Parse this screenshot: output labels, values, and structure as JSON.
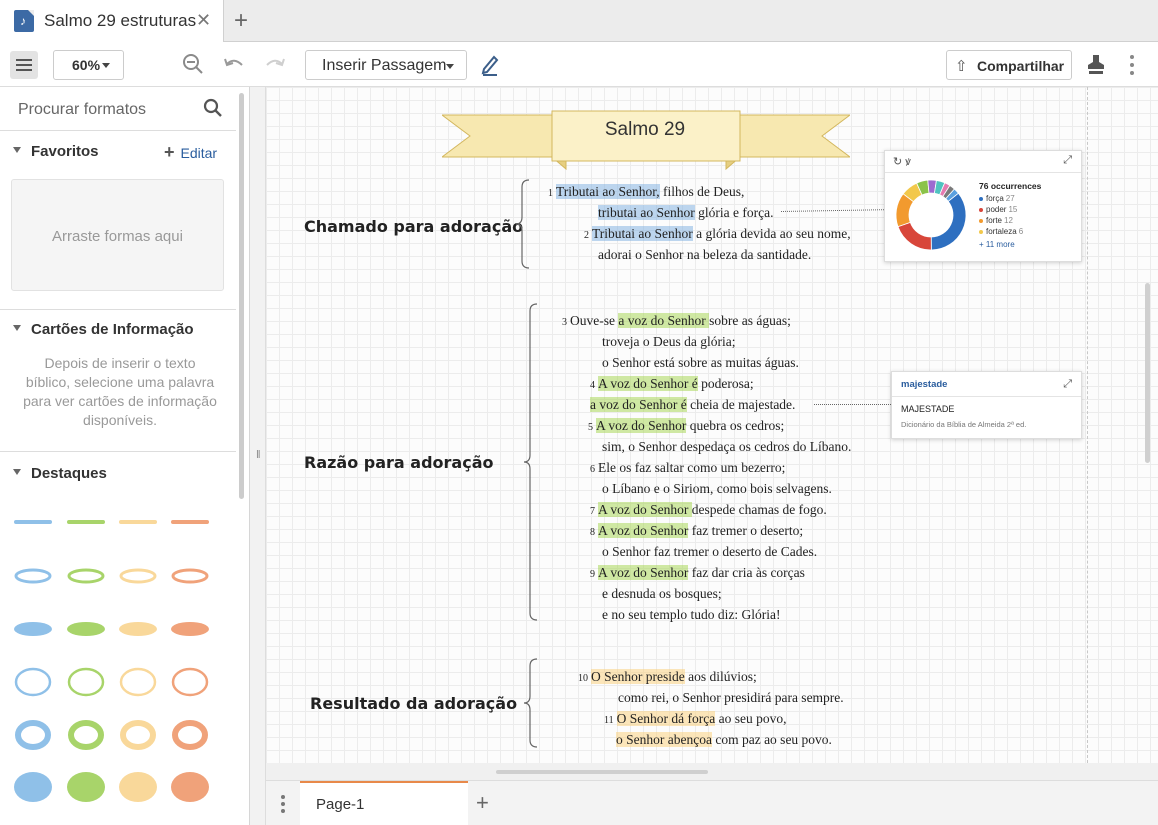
{
  "tab": {
    "title": "Salmo 29 estruturas",
    "close_icon": "close-icon",
    "add_icon": "plus-icon"
  },
  "toolbar": {
    "zoom": "60%",
    "insert_label": "Inserir Passagem",
    "share_label": "Compartilhar",
    "icons": [
      "menu-icon",
      "zoom-in-icon",
      "zoom-out-icon",
      "undo-icon",
      "redo-icon",
      "pen-icon",
      "share-icon",
      "stamp-icon",
      "more-vertical-icon"
    ]
  },
  "sidebar": {
    "search_placeholder": "Procurar formatos",
    "favorites": {
      "title": "Favoritos",
      "edit_label": "Editar",
      "dropzone_text": "Arraste formas aqui"
    },
    "info_cards": {
      "title": "Cartões de Informação",
      "text": "Depois de inserir o texto bíblico, selecione uma palavra para ver cartões de informação disponíveis."
    },
    "highlights": {
      "title": "Destaques",
      "colors": [
        "#8fc0e8",
        "#a8d46a",
        "#f9d89a",
        "#f0a27a"
      ],
      "styles": [
        "line",
        "loop",
        "flat",
        "ring",
        "thick-ring",
        "blob"
      ]
    }
  },
  "document": {
    "banner_title": "Salmo 29",
    "sections": [
      {
        "label": "Chamado para adoração",
        "lines": [
          {
            "num": "1",
            "pre": "",
            "hl": "Tributai ao Senhor,",
            "post": " filhos de Deus,",
            "color": "blue"
          },
          {
            "num": "",
            "pre": "",
            "hl": "tributai ao Senhor",
            "post": " glória e força.",
            "color": "blue"
          },
          {
            "num": "2",
            "pre": "",
            "hl": "Tributai ao Senhor",
            "post": " a glória devida ao seu nome,",
            "color": "blue"
          },
          {
            "num": "",
            "pre": "adorai o Senhor na beleza da santidade.",
            "hl": "",
            "post": "",
            "color": ""
          }
        ]
      },
      {
        "label": "Razão para adoração",
        "lines": [
          {
            "num": "3",
            "pre": "Ouve-se ",
            "hl": "a voz do Senhor ",
            "post": "sobre as águas;",
            "color": "green"
          },
          {
            "num": "",
            "pre": "troveja o Deus da glória;",
            "hl": "",
            "post": "",
            "color": ""
          },
          {
            "num": "",
            "pre": "o Senhor está sobre as muitas águas.",
            "hl": "",
            "post": "",
            "color": ""
          },
          {
            "num": "4",
            "pre": "",
            "hl": "A voz do Senhor é",
            "post": " poderosa;",
            "color": "green"
          },
          {
            "num": "",
            "pre": "",
            "hl": "a voz do Senhor é",
            "post": " cheia de majestade.",
            "color": "green"
          },
          {
            "num": "5",
            "pre": "",
            "hl": "A voz do Senhor",
            "post": " quebra os cedros;",
            "color": "green"
          },
          {
            "num": "",
            "pre": "sim, o Senhor despedaça os cedros do Líbano.",
            "hl": "",
            "post": "",
            "color": ""
          },
          {
            "num": "6",
            "pre": "Ele os faz saltar como um bezerro;",
            "hl": "",
            "post": "",
            "color": ""
          },
          {
            "num": "",
            "pre": "o Líbano e o Siriom,  como bois selvagens.",
            "hl": "",
            "post": "",
            "color": ""
          },
          {
            "num": "7",
            "pre": "",
            "hl": "A voz do Senhor ",
            "post": "despede chamas de fogo.",
            "color": "green"
          },
          {
            "num": "8",
            "pre": "",
            "hl": "A voz do Senhor",
            "post": " faz tremer o deserto;",
            "color": "green"
          },
          {
            "num": "",
            "pre": "o Senhor faz tremer o deserto de Cades.",
            "hl": "",
            "post": "",
            "color": ""
          },
          {
            "num": "9",
            "pre": "",
            "hl": "A voz do Senhor",
            "post": " faz dar cria às corças",
            "color": "green"
          },
          {
            "num": "",
            "pre": "e desnuda os bosques;",
            "hl": "",
            "post": "",
            "color": ""
          },
          {
            "num": "",
            "pre": "e no seu templo tudo diz: Glória!",
            "hl": "",
            "post": "",
            "color": ""
          }
        ]
      },
      {
        "label": "Resultado da adoração",
        "lines": [
          {
            "num": "10",
            "pre": "",
            "hl": "O Senhor preside",
            "post": " aos dilúvios;",
            "color": "yellow"
          },
          {
            "num": "",
            "pre": "como rei, o Senhor presidirá para sempre.",
            "hl": "",
            "post": "",
            "color": ""
          },
          {
            "num": "11",
            "pre": "",
            "hl": "O Senhor dá força",
            "post": " ao seu povo,",
            "color": "yellow"
          },
          {
            "num": "",
            "pre": "",
            "hl": "o Senhor abençoa",
            "post": " com paz ao seu povo.",
            "color": "yellow"
          }
        ]
      }
    ]
  },
  "word_card": {
    "icons": [
      "refresh-icon",
      "lexicon-icon",
      "open-card-icon"
    ],
    "occurrences_title": "76 occurrences",
    "items": [
      {
        "label": "força",
        "count": "27",
        "color": "#2e6fc0"
      },
      {
        "label": "poder",
        "count": "15",
        "color": "#d8463a"
      },
      {
        "label": "forte",
        "count": "12",
        "color": "#f29a2e"
      },
      {
        "label": "fortaleza",
        "count": "6",
        "color": "#f2c84b"
      }
    ],
    "more_label": "+ 11 more",
    "donut": [
      {
        "value": 27,
        "color": "#2e6fc0"
      },
      {
        "value": 15,
        "color": "#d8463a"
      },
      {
        "value": 12,
        "color": "#f29a2e"
      },
      {
        "value": 6,
        "color": "#f2c84b"
      },
      {
        "value": 4,
        "color": "#8bc34a"
      },
      {
        "value": 3,
        "color": "#9c6ad0"
      },
      {
        "value": 3,
        "color": "#4fc3c0"
      },
      {
        "value": 2,
        "color": "#e57bb0"
      },
      {
        "value": 2,
        "color": "#7a7a7a"
      },
      {
        "value": 2,
        "color": "#5aa0e0"
      }
    ]
  },
  "maj_card": {
    "title": "majestade",
    "word": "MAJESTADE",
    "source": "Dicionário da Bíblia de Almeida 2ª ed."
  },
  "pages": {
    "tab_label": "Page-1"
  }
}
